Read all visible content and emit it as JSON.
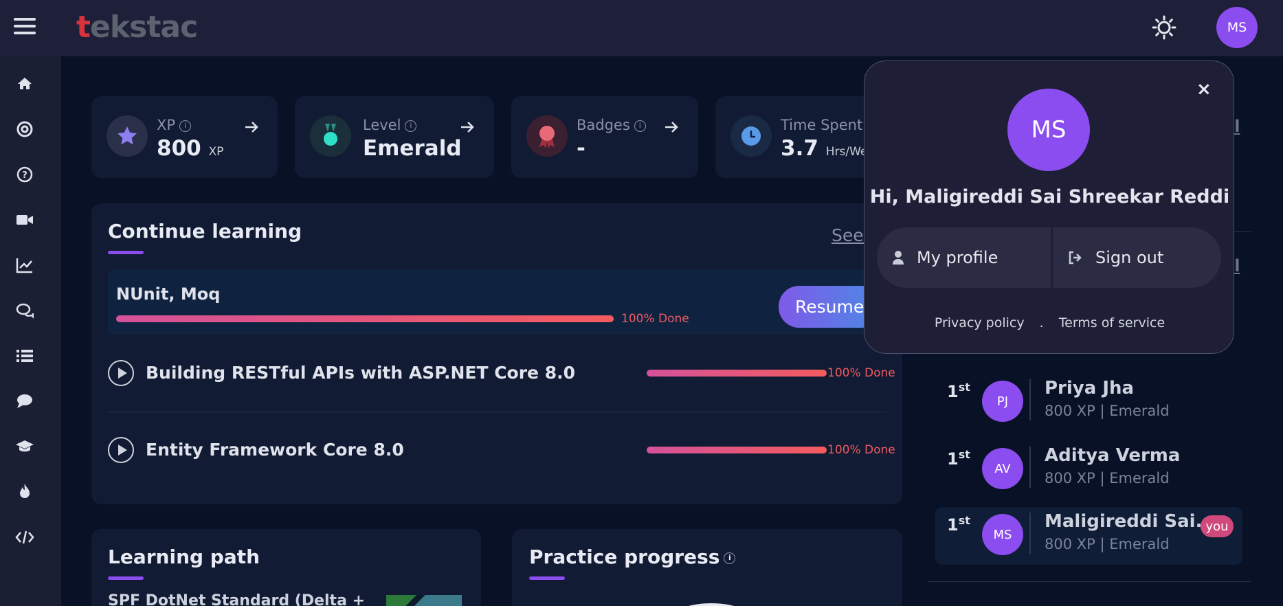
{
  "header": {
    "logo_first": "t",
    "logo_rest": "ekstac",
    "avatar": "MS"
  },
  "sidebar": {
    "icons": [
      "home-icon",
      "support-icon",
      "help-icon",
      "video-icon",
      "chart-icon",
      "chat-icon",
      "list-icon",
      "comment-icon",
      "graduation-icon",
      "fire-icon",
      "code-icon"
    ]
  },
  "stats": {
    "xp": {
      "label": "XP",
      "value": "800",
      "unit": "XP"
    },
    "level": {
      "label": "Level",
      "value": "Emerald"
    },
    "badges": {
      "label": "Badges",
      "value": "-"
    },
    "time": {
      "label": "Time Spent",
      "value": "3.7",
      "unit": "Hrs/Week"
    }
  },
  "continue_learning": {
    "title": "Continue learning",
    "see_all": "See all",
    "current": {
      "name": "NUnit, Moq",
      "progress_pct": 100,
      "done_label": "100% Done",
      "resume_label": "Resume"
    },
    "courses": [
      {
        "name": "Building RESTful APIs with ASP.NET Core 8.0",
        "progress_pct": 100,
        "done_label": "100% Done"
      },
      {
        "name": "Entity Framework Core 8.0",
        "progress_pct": 100,
        "done_label": "100% Done"
      }
    ]
  },
  "learning_path": {
    "title": "Learning path",
    "item": "SPF DotNet Standard (Delta +"
  },
  "practice_progress": {
    "title": "Practice progress"
  },
  "leaderboard": {
    "rows": [
      {
        "rank": "1",
        "suffix": "st",
        "initials": "PJ",
        "name": "Priya Jha",
        "sub": "800 XP | Emerald"
      },
      {
        "rank": "1",
        "suffix": "st",
        "initials": "AV",
        "name": "Aditya Verma",
        "sub": "800 XP | Emerald"
      },
      {
        "rank": "1",
        "suffix": "st",
        "initials": "MS",
        "name": "Maligireddi Sai...",
        "sub": "800 XP | Emerald",
        "you": "you"
      }
    ]
  },
  "profile_popup": {
    "avatar": "MS",
    "greeting": "Hi, Maligireddi Sai Shreekar Reddi",
    "my_profile": "My profile",
    "sign_out": "Sign out",
    "privacy": "Privacy policy",
    "dot": ".",
    "terms": "Terms of service",
    "close": "×"
  },
  "colors": {
    "accent": "#8b4cf0",
    "progress_start": "#d4529a",
    "progress_end": "#f35b5e",
    "done_text": "#f05a63",
    "badge_you": "#d1487a"
  }
}
